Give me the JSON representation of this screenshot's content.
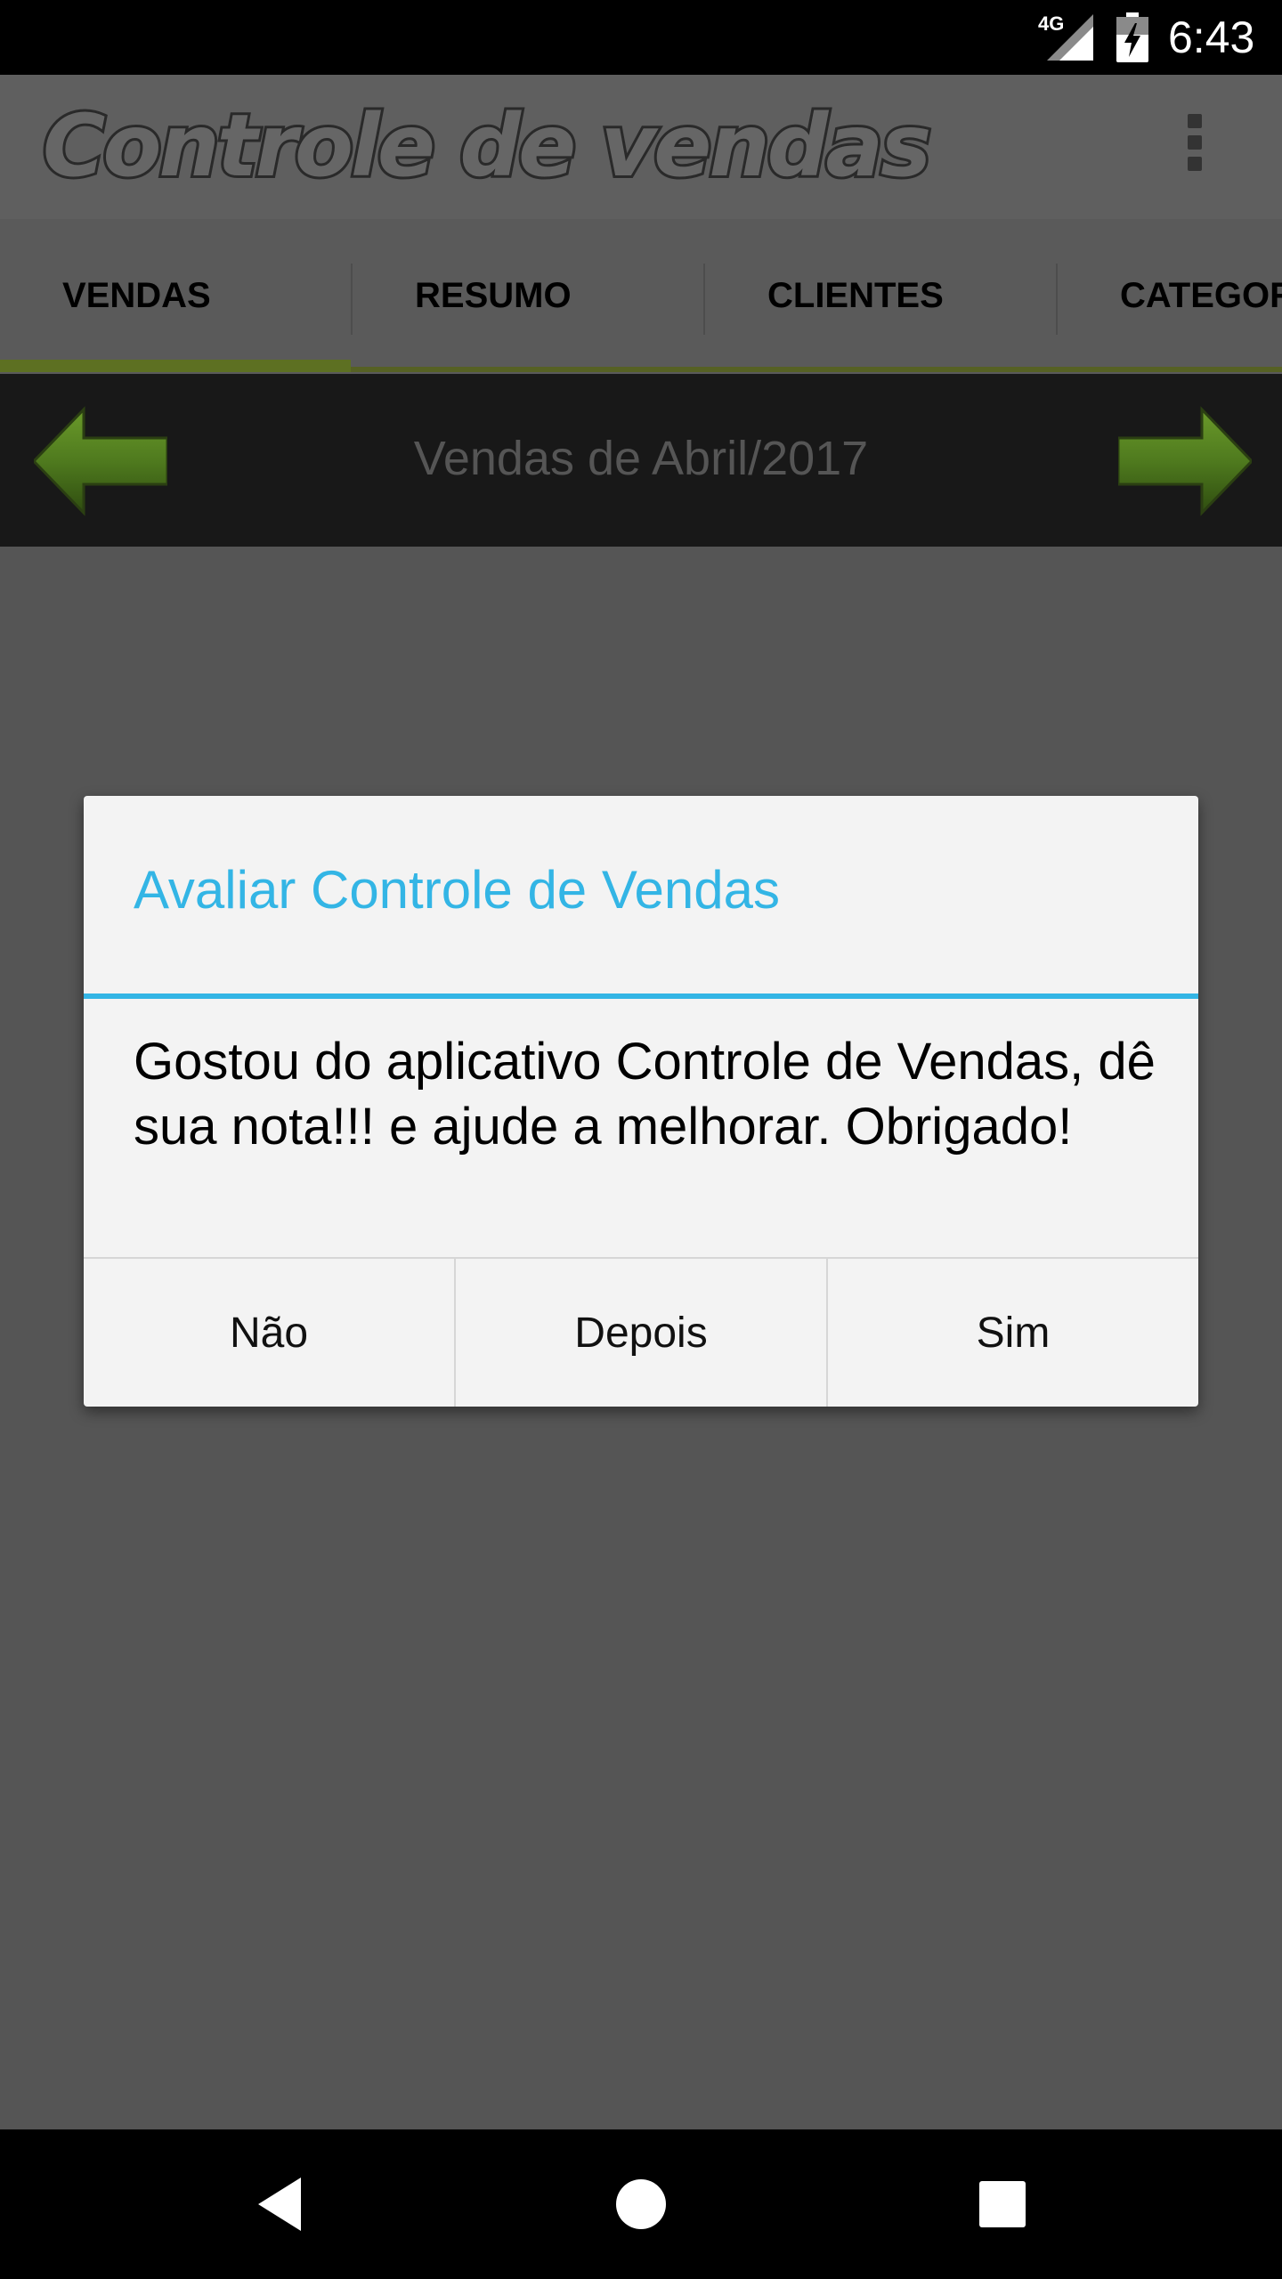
{
  "status_bar": {
    "network": "4G",
    "time": "6:43"
  },
  "app_bar": {
    "title": "Controle de vendas",
    "overflow_icon": "more-vert-icon"
  },
  "tabs": [
    {
      "label": "VENDAS",
      "active": true
    },
    {
      "label": "RESUMO",
      "active": false
    },
    {
      "label": "CLIENTES",
      "active": false
    },
    {
      "label": "CATEGOR",
      "active": false
    }
  ],
  "month_nav": {
    "title": "Vendas de Abril/2017",
    "prev_icon": "arrow-left-icon",
    "next_icon": "arrow-right-icon"
  },
  "dialog": {
    "title": "Avaliar Controle de Vendas",
    "message": "Gostou do aplicativo Controle de Vendas, dê sua nota!!! e ajude a melhorar. Obrigado!",
    "buttons": {
      "no": "Não",
      "later": "Depois",
      "yes": "Sim"
    }
  },
  "colors": {
    "accent": "#33b5e5",
    "tab_indicator": "#5d7022",
    "arrow_green": "#4f7a1e"
  },
  "nav_bar": {
    "back_icon": "back-icon",
    "home_icon": "home-icon",
    "recents_icon": "recents-icon"
  }
}
